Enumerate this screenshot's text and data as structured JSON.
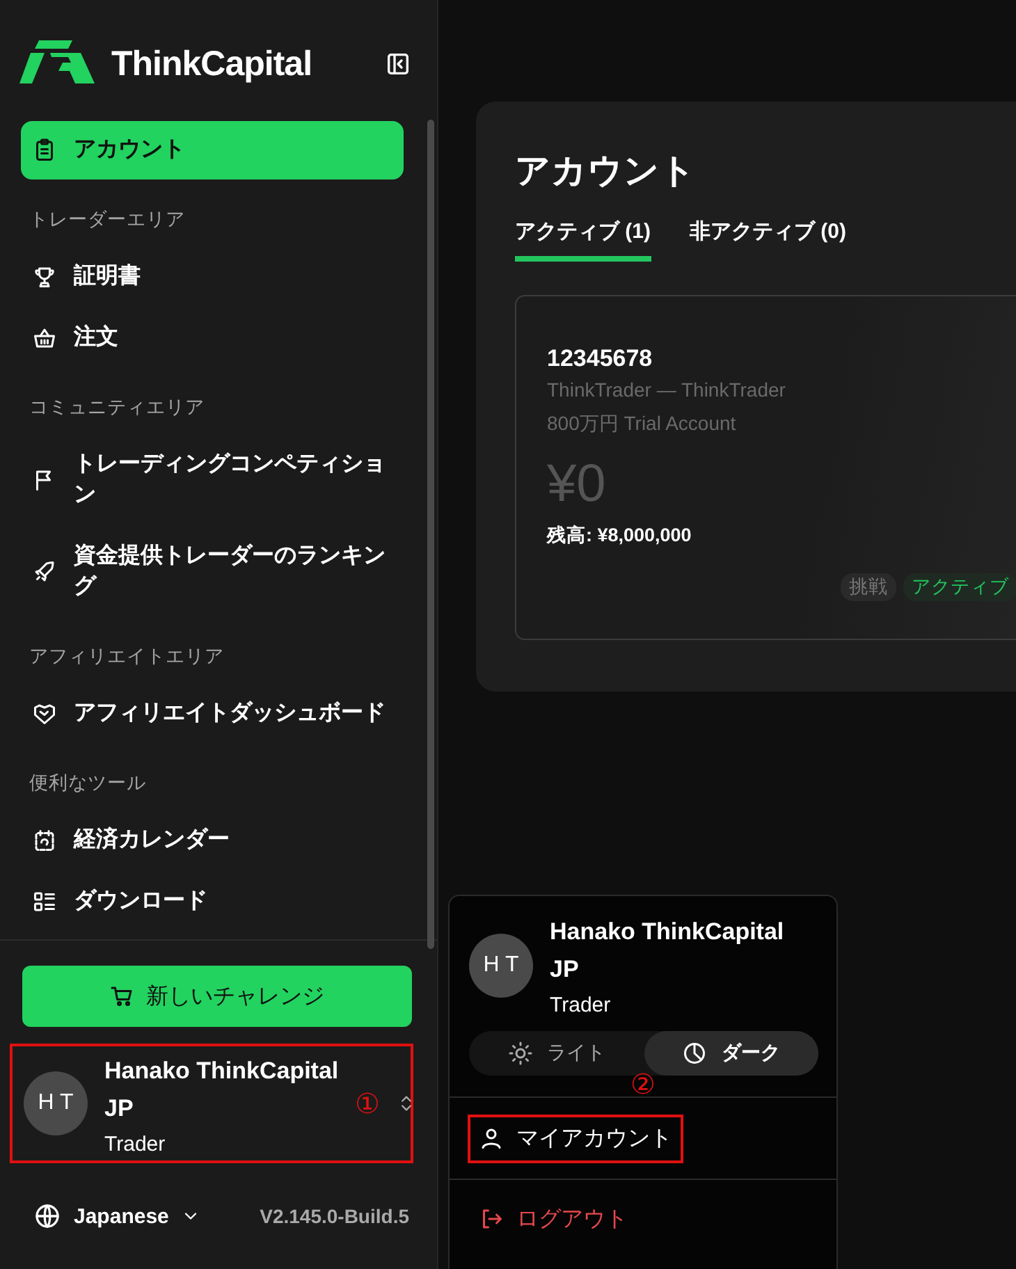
{
  "brand": {
    "name": "ThinkCapital"
  },
  "sidebar": {
    "items": [
      {
        "kind": "item",
        "label": "アカウント",
        "selected": true
      },
      {
        "kind": "section",
        "label": "トレーダーエリア"
      },
      {
        "kind": "item",
        "label": "証明書",
        "selected": false
      },
      {
        "kind": "item",
        "label": "注文",
        "selected": false
      },
      {
        "kind": "section",
        "label": "コミュニティエリア"
      },
      {
        "kind": "item",
        "label": "トレーディングコンペティション",
        "selected": false
      },
      {
        "kind": "item",
        "label": "資金提供トレーダーのランキング",
        "selected": false
      },
      {
        "kind": "section",
        "label": "アフィリエイトエリア"
      },
      {
        "kind": "item",
        "label": "アフィリエイトダッシュボード",
        "selected": false
      },
      {
        "kind": "section",
        "label": "便利なツール"
      },
      {
        "kind": "item",
        "label": "経済カレンダー",
        "selected": false
      },
      {
        "kind": "item",
        "label": "ダウンロード",
        "selected": false
      }
    ]
  },
  "new_challenge_button": {
    "label": "新しいチャレンジ"
  },
  "user": {
    "initials": "H T",
    "name": "Hanako ThinkCapital JP",
    "role": "Trader",
    "annotation": "①"
  },
  "footer": {
    "language": "Japanese",
    "version": "V2.145.0-Build.5"
  },
  "main": {
    "title": "アカウント",
    "tabs": [
      {
        "label": "アクティブ (1)",
        "selected": true
      },
      {
        "label": "非アクティブ (0)",
        "selected": false
      }
    ],
    "accounts": [
      {
        "number": "12345678",
        "platform": "ThinkTrader — ThinkTrader",
        "plan": "800万円 Trial Account",
        "profit": "¥0",
        "balance": "残高: ¥8,000,000",
        "tags": [
          {
            "label": "挑戦",
            "kind": "neutral"
          },
          {
            "label": "アクティブ",
            "kind": "active"
          }
        ]
      }
    ]
  },
  "user_menu": {
    "initials": "H T",
    "name": "Hanako ThinkCapital JP",
    "role": "Trader",
    "theme_options": [
      {
        "label": "ライト",
        "selected": false
      },
      {
        "label": "ダーク",
        "selected": true
      }
    ],
    "items": [
      {
        "label": "マイアカウント",
        "kind": "normal",
        "annotation": "②"
      },
      {
        "label": "ログアウト",
        "kind": "danger"
      }
    ]
  }
}
